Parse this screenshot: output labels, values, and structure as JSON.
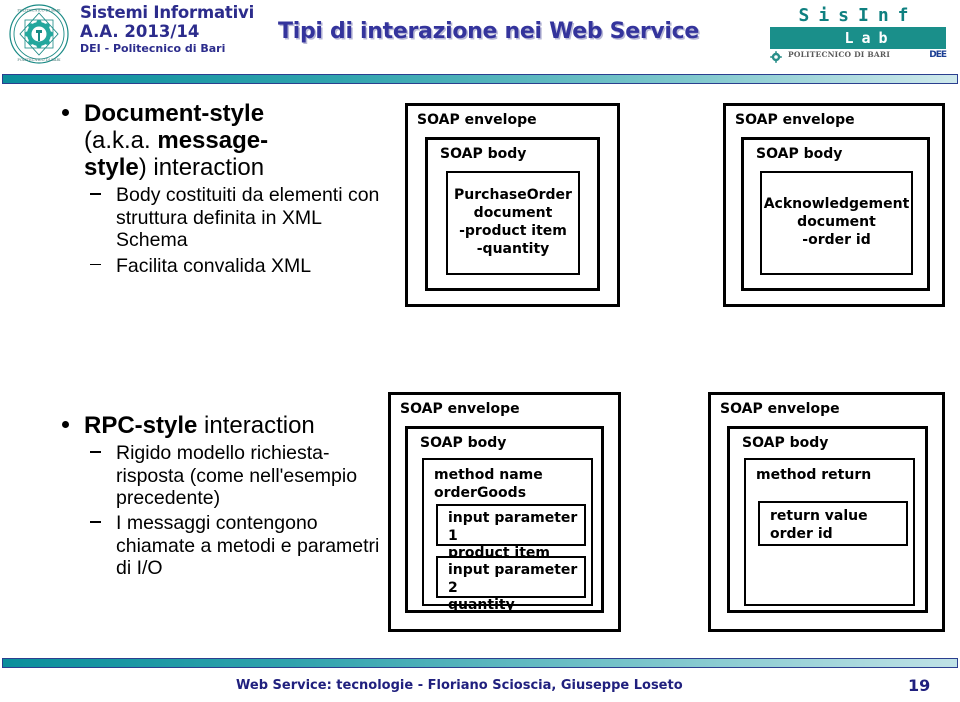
{
  "header": {
    "course_title": "Sistemi Informativi",
    "course_year": "A.A. 2013/14",
    "course_dept": "DEI - Politecnico di Bari",
    "slide_title": "Tipi di interazione nei Web Service",
    "lab_logo": {
      "top_text": "SisInf",
      "bar_text": "Lab",
      "footer_text": "POLITECNICO DI BARI",
      "dee_mark": "DEE"
    },
    "accent_teal": "#0f8080",
    "accent_navy": "#20207e"
  },
  "content": {
    "document_style": {
      "heading_plain_1": "Document-style",
      "heading_line2_pre": "(a.k.a. ",
      "heading_line2_bold": "message-",
      "heading_line3_bold": "style",
      "heading_line3_post": ") interaction",
      "sub_items": [
        "Body costituiti da elementi con struttura definita in XML Schema",
        "Facilita convalida XML"
      ]
    },
    "rpc_style": {
      "heading_bold": "RPC-style",
      "heading_plain": " interaction",
      "sub_items": [
        "Rigido modello richiesta-risposta (come nell'esempio precedente)",
        "I messaggi contengono chiamate a metodi e parametri di I/O"
      ]
    }
  },
  "diagrams": {
    "doc_request": {
      "envelope_label": "SOAP envelope",
      "body_label": "SOAP body",
      "payload_label": "PurchaseOrder\ndocument\n-product item\n-quantity"
    },
    "doc_response": {
      "envelope_label": "SOAP envelope",
      "body_label": "SOAP body",
      "payload_label": "Acknowledgement\ndocument\n-order id"
    },
    "rpc_request": {
      "envelope_label": "SOAP envelope",
      "body_label": "SOAP body",
      "method_label": "method name\norderGoods",
      "param1_label": "input parameter 1\nproduct item",
      "param2_label": "input parameter 2\nquantity"
    },
    "rpc_response": {
      "envelope_label": "SOAP envelope",
      "body_label": "SOAP body",
      "method_label": "method return",
      "return_label": "return value\norder id"
    }
  },
  "footer": {
    "text": "Web Service: tecnologie - Floriano Scioscia, Giuseppe Loseto",
    "page_number": "19"
  }
}
